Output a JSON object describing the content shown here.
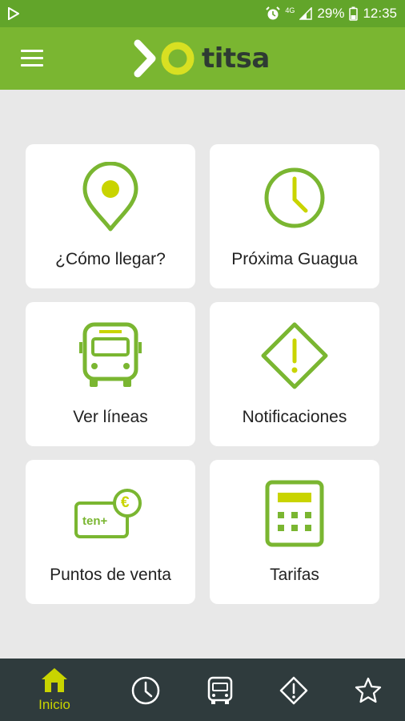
{
  "status_bar": {
    "network": "4G",
    "battery": "29%",
    "time": "12:35"
  },
  "app": {
    "logo_text": "titsa",
    "accent": "#c9d400",
    "brand_green": "#7ab631"
  },
  "tiles": [
    {
      "label": "¿Cómo llegar?",
      "icon": "location-pin-icon"
    },
    {
      "label": "Próxima Guagua",
      "icon": "clock-icon"
    },
    {
      "label": "Ver líneas",
      "icon": "bus-icon"
    },
    {
      "label": "Notificaciones",
      "icon": "warning-icon"
    },
    {
      "label": "Puntos de venta",
      "icon": "ten-card-euro-icon",
      "card_text": "ten+",
      "currency": "€"
    },
    {
      "label": "Tarifas",
      "icon": "calculator-icon"
    }
  ],
  "bottom_nav": [
    {
      "label": "Inicio",
      "icon": "home-icon",
      "active": true
    },
    {
      "icon": "clock-icon"
    },
    {
      "icon": "bus-icon"
    },
    {
      "icon": "warning-icon"
    },
    {
      "icon": "star-icon"
    }
  ]
}
